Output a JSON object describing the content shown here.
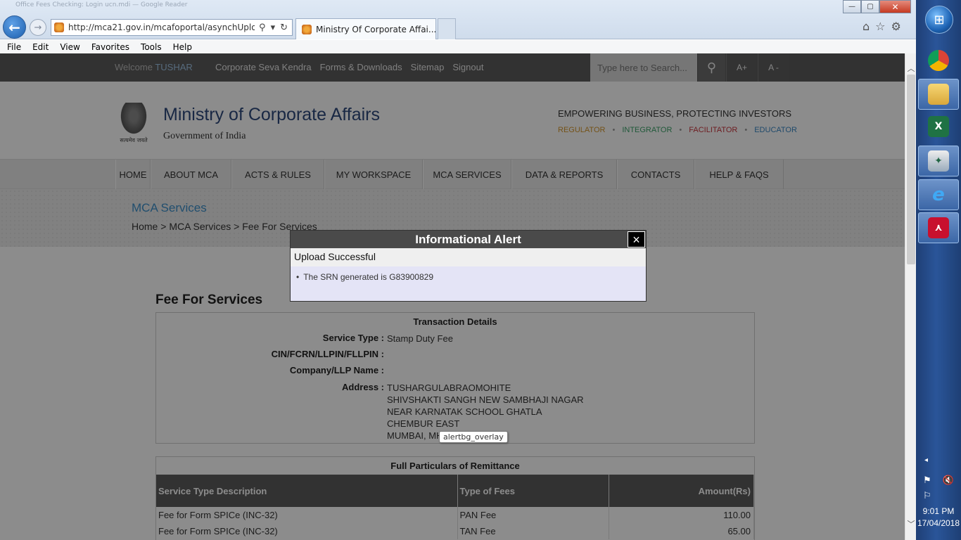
{
  "browser": {
    "ghost_title": "Office Fees Checking: Login ucn.mdi — Google Reader",
    "address_url": "http://mca21.gov.in/mcafoportal/asynchUpload.c",
    "address_tools": [
      "search-icon",
      "dropdown-icon",
      "refresh-icon"
    ],
    "tab_title": "Ministry Of Corporate Affai...",
    "tab_close": "×",
    "window_controls": {
      "minimize": "—",
      "maximize": "▢",
      "close": "✕"
    },
    "toolbar_icons": [
      "home-icon",
      "favorites-star-icon",
      "settings-gear-icon"
    ],
    "menu": [
      "File",
      "Edit",
      "View",
      "Favorites",
      "Tools",
      "Help"
    ]
  },
  "site": {
    "welcome_prefix": "Welcome",
    "welcome_user": "TUSHAR",
    "top_links": [
      "Corporate Seva Kendra",
      "Forms & Downloads",
      "Sitemap",
      "Signout"
    ],
    "search_placeholder": "Type here to Search...",
    "font_increase": "A+",
    "font_decrease": "A -",
    "emblem_motto": "सत्यमेव जयते",
    "title": "Ministry of Corporate Affairs",
    "subtitle": "Government of India",
    "tagline": "EMPOWERING BUSINESS, PROTECTING INVESTORS",
    "pillars": [
      {
        "label": "REGULATOR",
        "color": "#d4952b"
      },
      {
        "label": "INTEGRATOR",
        "color": "#3ca36a"
      },
      {
        "label": "FACILITATOR",
        "color": "#c9363e"
      },
      {
        "label": "EDUCATOR",
        "color": "#3b88c4"
      }
    ],
    "nav": [
      "HOME",
      "ABOUT MCA",
      "ACTS & RULES",
      "MY WORKSPACE",
      "MCA SERVICES",
      "DATA & REPORTS",
      "CONTACTS",
      "HELP & FAQS"
    ],
    "section_title": "MCA Services",
    "breadcrumb": [
      "Home",
      "MCA Services",
      "Fee For Services"
    ],
    "breadcrumb_sep": ">"
  },
  "page": {
    "heading": "Fee For Services",
    "transaction": {
      "title": "Transaction Details",
      "service_type_label": "Service Type :",
      "service_type_value": "Stamp Duty Fee",
      "cin_label": "CIN/FCRN/LLPIN/FLLPIN :",
      "cin_value": "",
      "company_label": "Company/LLP Name :",
      "company_value": "",
      "address_label": "Address :",
      "address_lines": [
        "TUSHARGULABRAOMOHITE",
        "SHIVSHAKTI SANGH NEW SAMBHAJI NAGAR",
        "NEAR KARNATAK SCHOOL GHATLA",
        "CHEMBUR EAST",
        "MUMBAI, MH"
      ]
    },
    "remittance": {
      "title": "Full Particulars of Remittance",
      "columns": [
        "Service Type Description",
        "Type of Fees",
        "Amount(Rs)"
      ],
      "rows": [
        [
          "Fee for Form SPICe (INC-32)",
          "PAN Fee",
          "110.00"
        ],
        [
          "Fee for Form SPICe (INC-32)",
          "TAN Fee",
          "65.00"
        ]
      ]
    }
  },
  "alert": {
    "title": "Informational Alert",
    "close": "×",
    "subtitle": "Upload Successful",
    "message": "The SRN generated is G83900829",
    "bullet": "•"
  },
  "tooltip": "alertbg_overlay",
  "taskbar": {
    "apps": [
      "chrome-icon",
      "file-explorer-icon",
      "excel-icon",
      "pigeon-app-icon",
      "internet-explorer-icon",
      "adobe-reader-icon"
    ],
    "time": "9:01 PM",
    "date": "17/04/2018",
    "tray_expand": "◂"
  }
}
